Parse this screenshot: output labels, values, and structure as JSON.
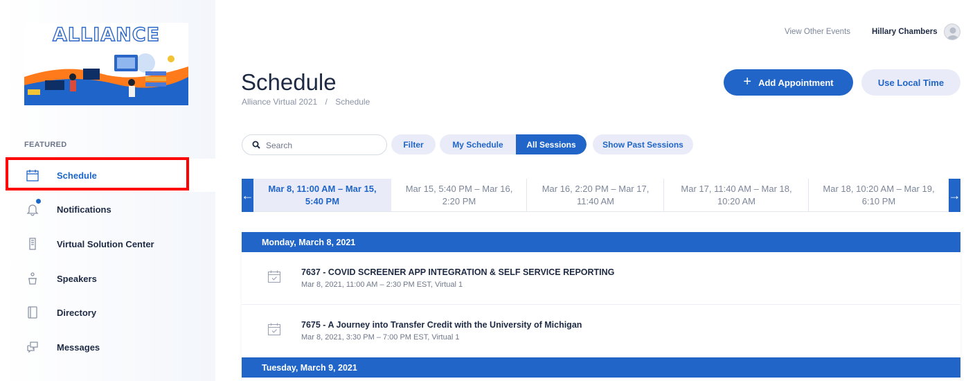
{
  "sidebar": {
    "logo_text": "ALLIANCE",
    "section_label": "FEATURED",
    "items": [
      {
        "label": "Schedule",
        "icon": "calendar-icon",
        "active": true
      },
      {
        "label": "Notifications",
        "icon": "bell-icon",
        "has_badge": true
      },
      {
        "label": "Virtual Solution Center",
        "icon": "building-icon"
      },
      {
        "label": "Speakers",
        "icon": "podium-icon"
      },
      {
        "label": "Directory",
        "icon": "book-icon"
      },
      {
        "label": "Messages",
        "icon": "chat-icon"
      }
    ]
  },
  "header": {
    "view_other_events": "View Other Events",
    "user_name": "Hillary Chambers",
    "title": "Schedule",
    "breadcrumb": [
      "Alliance Virtual 2021",
      "/",
      "Schedule"
    ],
    "add_appointment_label": "Add Appointment",
    "local_time_label": "Use Local Time"
  },
  "filters": {
    "search_placeholder": "Search",
    "filter_label": "Filter",
    "my_schedule_label": "My Schedule",
    "all_sessions_label": "All Sessions",
    "show_past_label": "Show Past Sessions"
  },
  "date_ranges": [
    {
      "line1": "Mar 8, 11:00 AM – Mar 15,",
      "line2": "5:40 PM",
      "active": true
    },
    {
      "line1": "Mar 15, 5:40 PM – Mar 16,",
      "line2": "2:20 PM"
    },
    {
      "line1": "Mar 16, 2:20 PM – Mar 17,",
      "line2": "11:40 AM"
    },
    {
      "line1": "Mar 17, 11:40 AM – Mar 18,",
      "line2": "10:20 AM"
    },
    {
      "line1": "Mar 18, 10:20 AM – Mar 19,",
      "line2": "6:10 PM"
    }
  ],
  "schedule": {
    "days": [
      {
        "label": "Monday, March 8, 2021",
        "sessions": [
          {
            "title": "7637 - COVID SCREENER APP INTEGRATION & SELF SERVICE REPORTING",
            "meta": "Mar 8, 2021, 11:00 AM – 2:30 PM EST, Virtual 1"
          },
          {
            "title": "7675 - A Journey into Transfer Credit with the University of Michigan",
            "meta": "Mar 8, 2021, 3:30 PM – 7:00 PM EST, Virtual 1"
          }
        ]
      },
      {
        "label": "Tuesday, March 9, 2021",
        "sessions": []
      }
    ]
  },
  "colors": {
    "accent": "#2065c7",
    "pill_bg": "#e9ecf8",
    "highlight": "#ff0000"
  }
}
